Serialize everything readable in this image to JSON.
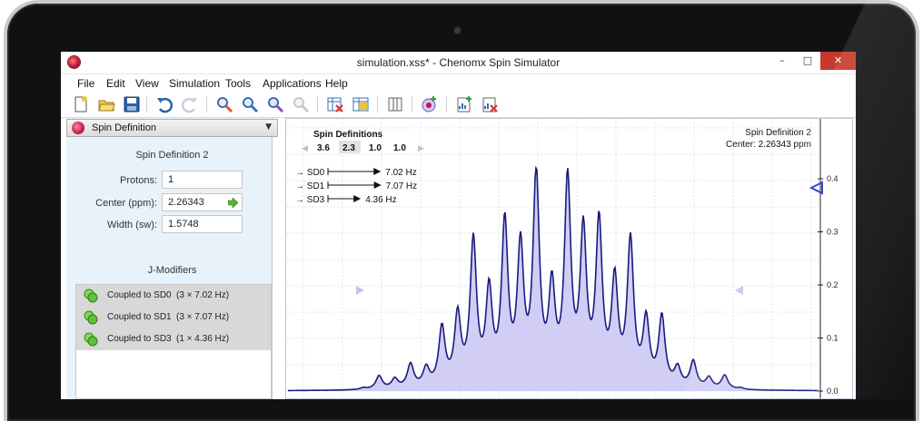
{
  "window": {
    "title": "simulation.xss* - Chenomx Spin Simulator",
    "minimize": "–",
    "maximize": "□",
    "close": "✕"
  },
  "menu": [
    "File",
    "Edit",
    "View",
    "Simulation",
    "Tools",
    "Applications",
    "Help"
  ],
  "toolbar": {
    "icons": [
      "new-document-icon",
      "open-folder-icon",
      "save-icon",
      "undo-icon",
      "redo-icon",
      "zoom-red-icon",
      "zoom-blue-icon",
      "zoom-purple-icon",
      "zoom-disabled-icon",
      "delete-table-icon",
      "table-icon",
      "split-view-icon",
      "add-spin-icon",
      "add-chart-icon",
      "delete-chart-icon"
    ]
  },
  "left_panel": {
    "dropdown_label": "Spin Definition",
    "heading": "Spin Definition 2",
    "fields": [
      {
        "label": "Protons:",
        "value": "1"
      },
      {
        "label": "Center (ppm):",
        "value": "2.26343"
      },
      {
        "label": "Width (sw):",
        "value": "1.5748"
      }
    ],
    "jmod_heading": "J-Modifiers",
    "jmods": [
      {
        "name": "Coupled to SD0",
        "value": "(3 × 7.02 Hz)"
      },
      {
        "name": "Coupled to SD1",
        "value": "(3 × 7.07 Hz)"
      },
      {
        "name": "Coupled to SD3",
        "value": "(1 × 4.36 Hz)"
      }
    ]
  },
  "plot": {
    "spin_defs_title": "Spin Definitions",
    "spin_defs_values": [
      "3.6",
      "2.3",
      "1.0",
      "1.0"
    ],
    "selected_index": 1,
    "info_title": "Spin Definition 2",
    "info_center": "Center: 2.26343 ppm",
    "couplings": [
      {
        "label": "→ SD0",
        "value": "7.02 Hz"
      },
      {
        "label": "→ SD1",
        "value": "7.07 Hz"
      },
      {
        "label": "→ SD3",
        "value": "4.36 Hz"
      }
    ],
    "coupling_hz": [
      7.02,
      7.07,
      4.36
    ],
    "y_ticks": [
      "0.4",
      "0.3",
      "0.2",
      "0.1",
      "0.0"
    ],
    "colors": {
      "line": "#1a1a80",
      "fill": "#c9c4f2",
      "marker": "#2233cc",
      "nav": "#c7c3ee"
    }
  },
  "chart_data": {
    "type": "line",
    "title": "",
    "xlabel": "",
    "ylabel": "",
    "ylim": [
      0,
      0.42
    ],
    "y_ticks": [
      0.0,
      0.1,
      0.2,
      0.3,
      0.4
    ],
    "grid": true,
    "x": [
      0,
      1,
      2,
      3,
      4,
      5,
      6,
      7,
      8,
      9,
      10,
      11,
      12,
      13,
      14,
      15,
      16,
      17,
      18,
      19,
      20,
      21,
      22,
      23,
      24
    ],
    "series": [
      {
        "values": [
          0.003,
          0.025,
          0.018,
          0.045,
          0.035,
          0.11,
          0.13,
          0.27,
          0.17,
          0.3,
          0.25,
          0.39,
          0.17,
          0.38,
          0.28,
          0.3,
          0.19,
          0.27,
          0.12,
          0.13,
          0.035,
          0.05,
          0.02,
          0.026,
          0.003
        ]
      }
    ]
  }
}
